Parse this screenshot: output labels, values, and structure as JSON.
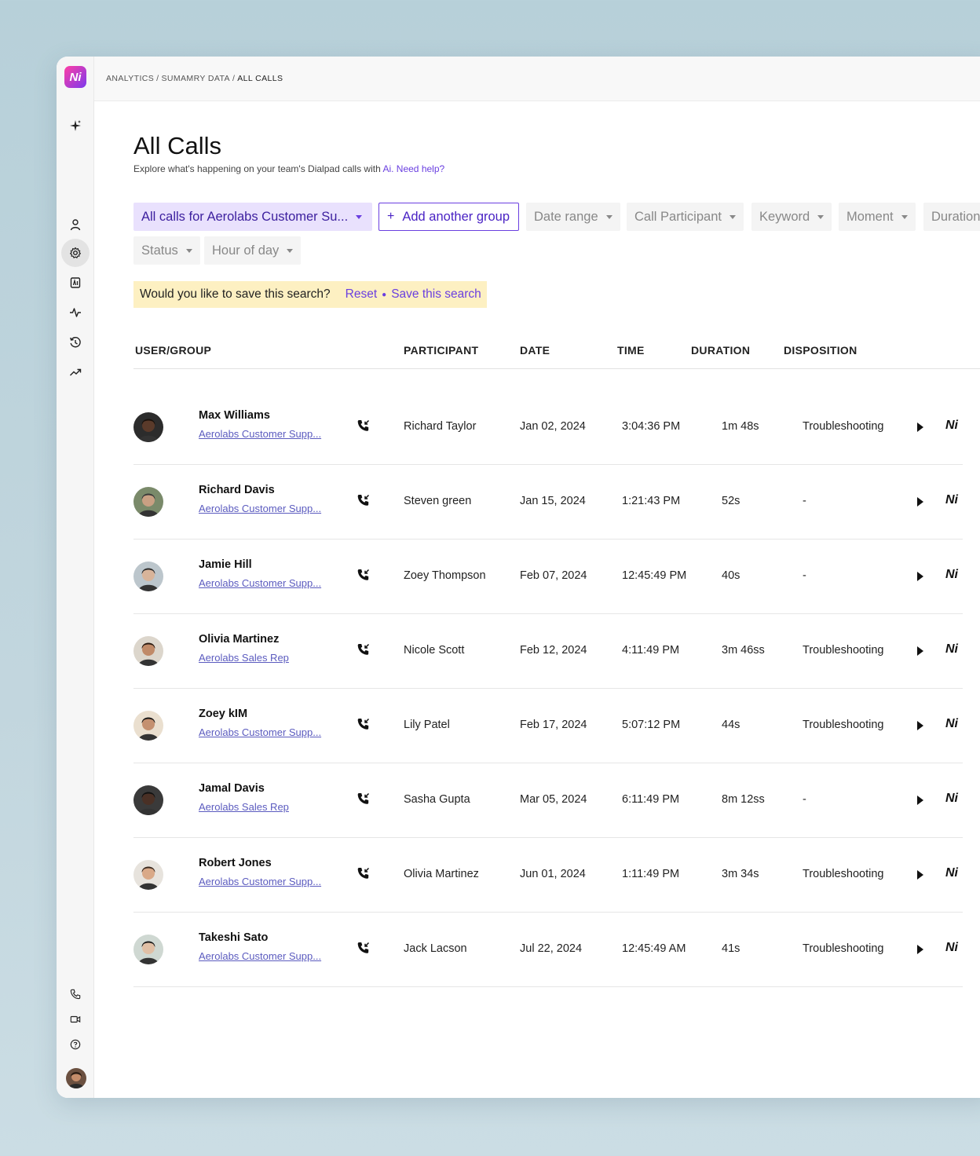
{
  "app": {
    "logo_text": "Ni"
  },
  "breadcrumb": {
    "part1": "ANALYTICS",
    "sep1": "/",
    "part2": "SUMAMRY DATA",
    "sep2": "/",
    "current": "ALL CALLS"
  },
  "page": {
    "title": "All Calls",
    "subtitle_prefix": "Explore what's happening on your team's Dialpad calls with ",
    "subtitle_link1": "Ai.",
    "subtitle_link2": "Need help?"
  },
  "filters": {
    "group": "All calls for Aerolabs Customer Su...",
    "add_group": "Add another group",
    "date_range": "Date range",
    "call_participant": "Call Participant",
    "keyword": "Keyword",
    "moment": "Moment",
    "duration": "Duration",
    "status": "Status",
    "hour_of_day": "Hour of day"
  },
  "save_search": {
    "question": "Would you like to save this search?",
    "reset": "Reset",
    "save": "Save this search"
  },
  "table": {
    "headers": {
      "user": "USER/GROUP",
      "participant": "PARTICIPANT",
      "date": "DATE",
      "time": "TIME",
      "duration": "DURATION",
      "disposition": "DISPOSITION"
    },
    "rows": [
      {
        "name": "Max Williams",
        "group": "Aerolabs Customer Supp...",
        "participant": "Richard Taylor",
        "date": "Jan 02, 2024",
        "time": "3:04:36 PM",
        "duration": "1m 48s",
        "disposition": "Troubleshooting",
        "ai": "Ni"
      },
      {
        "name": "Richard Davis",
        "group": "Aerolabs Customer Supp...",
        "participant": "Steven green",
        "date": "Jan 15, 2024",
        "time": "1:21:43 PM",
        "duration": "52s",
        "disposition": "-",
        "ai": "Ni"
      },
      {
        "name": "Jamie Hill",
        "group": "Aerolabs Customer Supp...",
        "participant": "Zoey Thompson",
        "date": "Feb 07, 2024",
        "time": "12:45:49 PM",
        "duration": "40s",
        "disposition": "-",
        "ai": "Ni"
      },
      {
        "name": "Olivia Martinez",
        "group": "Aerolabs Sales Rep",
        "participant": "Nicole Scott",
        "date": "Feb 12, 2024",
        "time": "4:11:49 PM",
        "duration": "3m 46ss",
        "disposition": "Troubleshooting",
        "ai": "Ni"
      },
      {
        "name": "Zoey kIM",
        "group": "Aerolabs Customer Supp...",
        "participant": "Lily Patel",
        "date": "Feb 17, 2024",
        "time": "5:07:12 PM",
        "duration": "44s",
        "disposition": "Troubleshooting",
        "ai": "Ni"
      },
      {
        "name": "Jamal Davis",
        "group": "Aerolabs Sales Rep",
        "participant": "Sasha Gupta",
        "date": "Mar 05, 2024",
        "time": "6:11:49 PM",
        "duration": "8m 12ss",
        "disposition": "-",
        "ai": "Ni"
      },
      {
        "name": "Robert Jones",
        "group": "Aerolabs Customer Supp...",
        "participant": "Olivia Martinez",
        "date": "Jun 01, 2024",
        "time": "1:11:49 PM",
        "duration": "3m 34s",
        "disposition": "Troubleshooting",
        "ai": "Ni"
      },
      {
        "name": "Takeshi Sato",
        "group": "Aerolabs Customer Supp...",
        "participant": "Jack Lacson",
        "date": "Jul 22, 2024",
        "time": "12:45:49 AM",
        "duration": "41s",
        "disposition": "Troubleshooting",
        "ai": "Ni"
      }
    ]
  },
  "colors": {
    "accent": "#6a3fe0",
    "primary_chip_bg": "#e9e1fd",
    "save_bar_bg": "#fdf0c2"
  }
}
